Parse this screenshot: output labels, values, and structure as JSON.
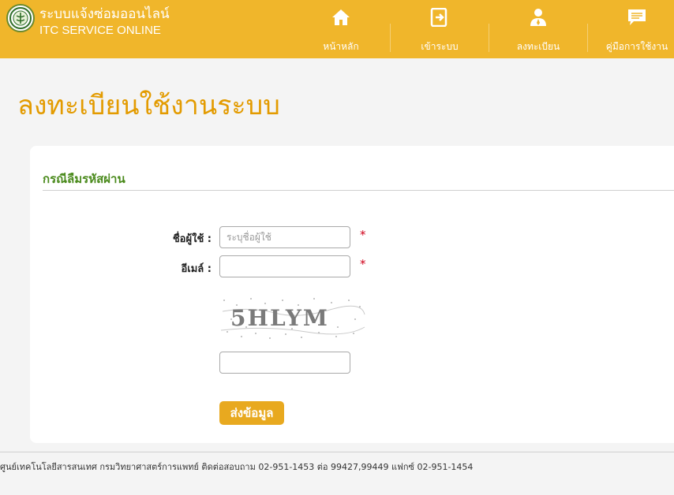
{
  "header": {
    "brand_title": "ระบบแจ้งซ่อมออนไลน์",
    "brand_subtitle": "ITC SERVICE ONLINE",
    "nav": [
      {
        "label": "หน้าหลัก",
        "icon": "home-icon"
      },
      {
        "label": "เข้าระบบ",
        "icon": "login-icon"
      },
      {
        "label": "ลงทะเบียน",
        "icon": "user-register-icon"
      },
      {
        "label": "คู่มือการใช้งาน",
        "icon": "manual-chat-icon"
      }
    ]
  },
  "page": {
    "title": "ลงทะเบียนใช้งานระบบ"
  },
  "form": {
    "section_title": "กรณีลืมรหัสผ่าน",
    "username_label": "ชื่อผู้ใช้ :",
    "username_placeholder": "ระบุชื่อผู้ใช้",
    "username_value": "",
    "email_label": "อีเมล์ :",
    "email_value": "",
    "required_mark": "*",
    "captcha_text": "5HLYM",
    "captcha_value": "",
    "submit_label": "ส่งข้อมูล"
  },
  "footer": {
    "text": "ศูนย์เทคโนโลยีสารสนเทศ กรมวิทยาศาสตร์การแพทย์ ติดต่อสอบถาม 02-951-1453 ต่อ 99427,99449 แฟกซ์ 02-951-1454"
  },
  "colors": {
    "header_bg": "#f0b62b",
    "title": "#e39b00",
    "section_title": "#4a8a1c",
    "button": "#e8a91f",
    "required": "#d0021b"
  }
}
